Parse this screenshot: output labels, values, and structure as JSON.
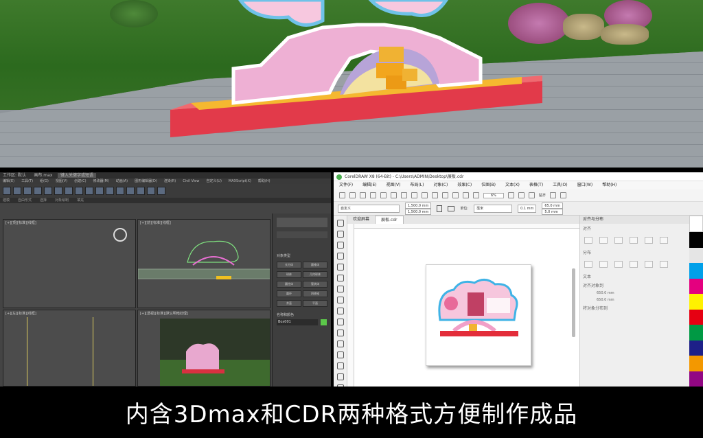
{
  "max_window": {
    "workspace": "工作区: 默认",
    "file_name": "画布.max",
    "search": "键入关键字或短语",
    "menu": [
      "编辑(E)",
      "工具(T)",
      "组(G)",
      "视图(V)",
      "创建(C)",
      "修改器(M)",
      "动画(A)",
      "图形编辑器(D)",
      "渲染(R)",
      "Civil View",
      "自定义(U)",
      "MAXScript(X)",
      "帮助(H)"
    ],
    "ribbon": [
      "建模",
      "自由形式",
      "选择",
      "对象绘制",
      "填充"
    ],
    "viewport_labels": [
      "[+][顶][标准][线框]",
      "[+][前][标准][线框]",
      "[+][左][标准][线框]",
      "[+][透视][标准][默认明暗处理]"
    ],
    "cmd_title": "对象类型",
    "cmd_buttons": [
      "长方体",
      "圆锥体",
      "球体",
      "几何球体",
      "圆柱体",
      "管状体",
      "圆环",
      "四棱锥",
      "茶壶",
      "平面"
    ],
    "name_color": "名称和颜色",
    "name_value": "Box001"
  },
  "cdr_window": {
    "title": "CorelDRAW X8 (64-Bit) - C:\\Users\\ADMIN\\Desktop\\展板.cdr",
    "menu": [
      "文件(F)",
      "编辑(E)",
      "视图(V)",
      "布局(L)",
      "对象(C)",
      "效果(C)",
      "位图(B)",
      "文本(X)",
      "表格(T)",
      "工具(O)",
      "窗口(W)",
      "帮助(H)"
    ],
    "preset": "自定义",
    "width": "1,500.0 mm",
    "height": "1,500.0 mm",
    "units_label": "单位:",
    "units": "毫米",
    "nudge": "0.1 mm",
    "dup_x": "65.0 mm",
    "dup_y": "5.0 mm",
    "zoom": "6%",
    "snap": "贴齐",
    "tabs": [
      "欢迎屏幕",
      "展板.cdr"
    ],
    "docker_title": "对齐与分布",
    "docker_sections": [
      "对齐",
      "分布",
      "文本",
      "对齐对象到",
      "将对象分布到"
    ],
    "docker_x": "650.0 mm",
    "docker_y": "650.0 mm"
  },
  "caption": "内含3Dmax和CDR两种格式方便制作成品"
}
